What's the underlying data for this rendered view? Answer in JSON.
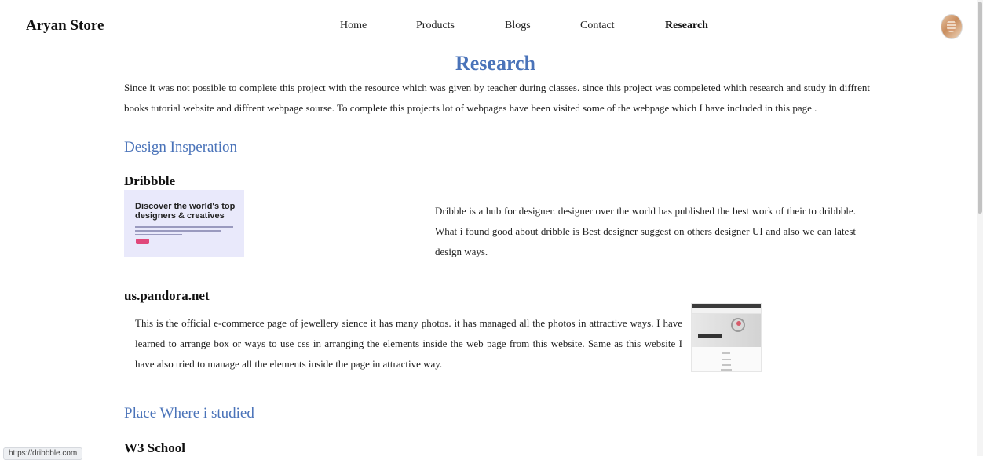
{
  "header": {
    "brand": "Aryan Store",
    "nav": [
      "Home",
      "Products",
      "Blogs",
      "Contact",
      "Research"
    ],
    "active_nav": "Research"
  },
  "page": {
    "title": "Research",
    "intro": "Since it was not possible to complete this project with the resource which was given by teacher during classes. since this project was compeleted whith research and study in diffrent books tutorial website and diffrent webpage sourse. To complete this projects lot of webpages have been visited some of the webpage which I have included in this page ."
  },
  "sections": {
    "design_heading": "Design Insperation",
    "dribbble": {
      "title": "Dribbble",
      "thumb_headline": "Discover the world's top designers & creatives",
      "description": "Dribble is a hub for designer. designer over the world has published the best work of their to dribbble. What i found good about dribble is Best designer suggest on others designer UI and also we can latest design ways."
    },
    "pandora": {
      "title": "us.pandora.net",
      "description": "This is the official e-commerce page of jewellery sience it has many photos. it has managed all the photos in attractive ways. I have learned to arrange box or ways to use css in arranging the elements inside the web page from this website. Same as this website I have also tried to manage all the elements inside the page in attractive way."
    },
    "studied_heading": "Place Where i studied",
    "w3": {
      "title": "W3 School"
    }
  },
  "status_url": "https://dribbble.com",
  "colors": {
    "accent_blue": "#4a73b9",
    "text": "#222222"
  }
}
